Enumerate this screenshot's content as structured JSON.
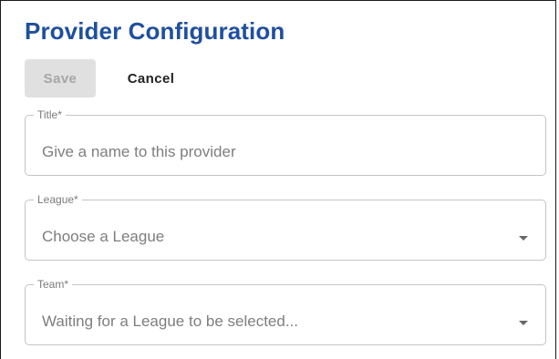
{
  "page": {
    "title": "Provider Configuration"
  },
  "toolbar": {
    "save_label": "Save",
    "cancel_label": "Cancel"
  },
  "form": {
    "title_field": {
      "label": "Title*",
      "placeholder": "Give a name to this provider",
      "value": ""
    },
    "league_field": {
      "label": "League*",
      "selected": "Choose a League",
      "icon": "caret-down-icon"
    },
    "team_field": {
      "label": "Team*",
      "selected": "Waiting for a League to be selected...",
      "icon": "caret-down-icon"
    }
  },
  "colors": {
    "title": "#1f4f9e",
    "save_button_bg": "#e0e0e0",
    "save_button_text": "#a6a6a6",
    "field_border": "#c4c4c4",
    "field_text": "#7e7e7e"
  }
}
